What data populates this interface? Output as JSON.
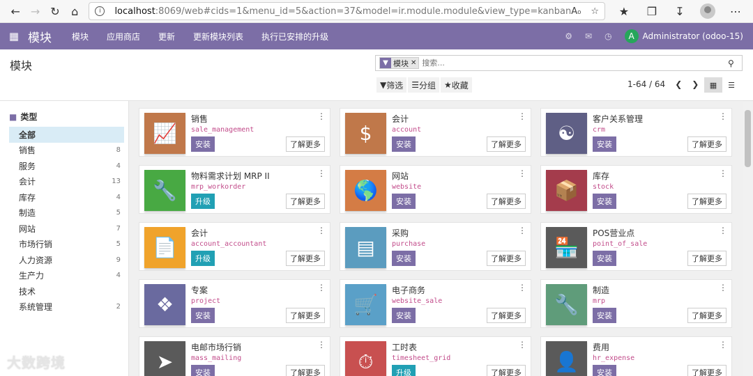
{
  "browser": {
    "url_host": "localhost",
    "url_rest": ":8069/web#cids=1&menu_id=5&action=37&model=ir.module.module&view_type=kanban"
  },
  "topnav": {
    "app_title": "模块",
    "items": [
      "模块",
      "应用商店",
      "更新",
      "更新模块列表",
      "执行已安排的升级"
    ],
    "user_initial": "A",
    "user_name": "Administrator (odoo-15)",
    "bg_color": "#7c6ea6"
  },
  "control": {
    "title": "模块",
    "facet_label": "模块",
    "search_placeholder": "搜索...",
    "filters": [
      "筛选",
      "分组",
      "收藏"
    ],
    "pager": "1-64 / 64"
  },
  "sidebar": {
    "heading": "类型",
    "items": [
      {
        "label": "全部",
        "count": ""
      },
      {
        "label": "销售",
        "count": "8"
      },
      {
        "label": "服务",
        "count": "4"
      },
      {
        "label": "会计",
        "count": "13"
      },
      {
        "label": "库存",
        "count": "4"
      },
      {
        "label": "制造",
        "count": "5"
      },
      {
        "label": "网站",
        "count": "7"
      },
      {
        "label": "市场行销",
        "count": "5"
      },
      {
        "label": "人力资源",
        "count": "9"
      },
      {
        "label": "生产力",
        "count": "4"
      },
      {
        "label": "技术",
        "count": ""
      },
      {
        "label": "系统管理",
        "count": "2"
      }
    ]
  },
  "learn_more": "了解更多",
  "modules": [
    {
      "name": "销售",
      "tech": "sale_management",
      "action": "安装",
      "kind": "install",
      "color": "#c0784a",
      "icon": "chart-icon"
    },
    {
      "name": "会计",
      "tech": "account",
      "action": "安装",
      "kind": "install",
      "color": "#c0784a",
      "icon": "invoice-icon"
    },
    {
      "name": "客户关系管理",
      "tech": "crm",
      "action": "安装",
      "kind": "install",
      "color": "#5f5f85",
      "icon": "handshake-icon"
    },
    {
      "name": "物料需求计划 MRP II",
      "tech": "mrp_workorder",
      "action": "升级",
      "kind": "upgrade",
      "color": "#48a943",
      "icon": "wrench-icon"
    },
    {
      "name": "网站",
      "tech": "website",
      "action": "安装",
      "kind": "install",
      "color": "#d47c45",
      "icon": "globe-icon"
    },
    {
      "name": "库存",
      "tech": "stock",
      "action": "安装",
      "kind": "install",
      "color": "#a43c4c",
      "icon": "box-icon"
    },
    {
      "name": "会计",
      "tech": "account_accountant",
      "action": "升级",
      "kind": "upgrade",
      "color": "#f0a32b",
      "icon": "document-icon"
    },
    {
      "name": "采购",
      "tech": "purchase",
      "action": "安装",
      "kind": "install",
      "color": "#5b9cbf",
      "icon": "card-icon"
    },
    {
      "name": "POS营业点",
      "tech": "point_of_sale",
      "action": "安装",
      "kind": "install",
      "color": "#5a5a5a",
      "icon": "shop-icon"
    },
    {
      "name": "专案",
      "tech": "project",
      "action": "安装",
      "kind": "install",
      "color": "#6a6a9f",
      "icon": "puzzle-icon"
    },
    {
      "name": "电子商务",
      "tech": "website_sale",
      "action": "安装",
      "kind": "install",
      "color": "#5aa0c8",
      "icon": "cart-icon"
    },
    {
      "name": "制造",
      "tech": "mrp",
      "action": "安装",
      "kind": "install",
      "color": "#5f9c7a",
      "icon": "wrench-icon"
    },
    {
      "name": "电邮市场行销",
      "tech": "mass_mailing",
      "action": "安装",
      "kind": "install",
      "color": "#5a5a5a",
      "icon": "paper-plane-icon"
    },
    {
      "name": "工时表",
      "tech": "timesheet_grid",
      "action": "升级",
      "kind": "upgrade",
      "color": "#c85050",
      "icon": "stopwatch-icon"
    },
    {
      "name": "费用",
      "tech": "hr_expense",
      "action": "安装",
      "kind": "install",
      "color": "#5a5a5a",
      "icon": "expense-icon"
    }
  ],
  "watermark": "大数跨境"
}
